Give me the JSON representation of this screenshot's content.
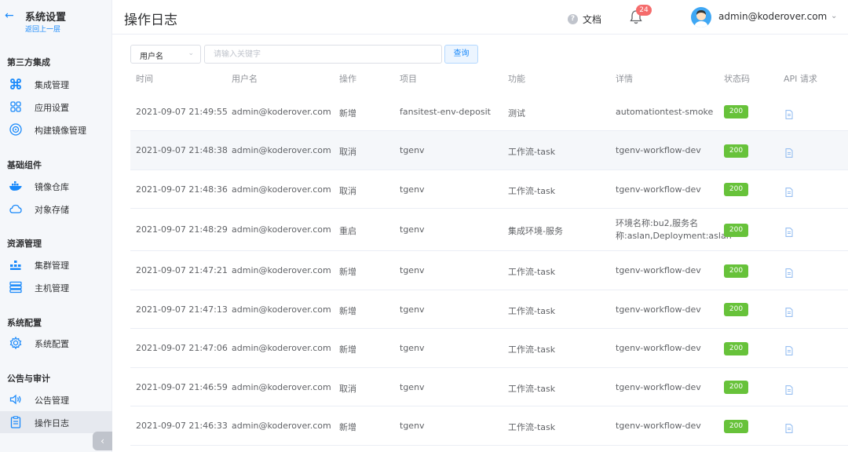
{
  "sidebar": {
    "title": "系统设置",
    "back_label": "返回上一层",
    "sections": [
      {
        "title": "第三方集成",
        "items": [
          {
            "label": "集成管理",
            "icon": "integration-icon"
          },
          {
            "label": "应用设置",
            "icon": "apps-grid-icon"
          },
          {
            "label": "构建镜像管理",
            "icon": "build-image-icon"
          }
        ]
      },
      {
        "title": "基础组件",
        "items": [
          {
            "label": "镜像仓库",
            "icon": "docker-icon"
          },
          {
            "label": "对象存储",
            "icon": "cloud-icon"
          }
        ]
      },
      {
        "title": "资源管理",
        "items": [
          {
            "label": "集群管理",
            "icon": "cluster-icon"
          },
          {
            "label": "主机管理",
            "icon": "server-icon"
          }
        ]
      },
      {
        "title": "系统配置",
        "items": [
          {
            "label": "系统配置",
            "icon": "gear-icon"
          }
        ]
      },
      {
        "title": "公告与审计",
        "items": [
          {
            "label": "公告管理",
            "icon": "speaker-icon"
          },
          {
            "label": "操作日志",
            "icon": "clipboard-icon",
            "active": true
          }
        ]
      }
    ],
    "collapse_icon": "chevron-left-icon"
  },
  "header": {
    "title": "操作日志",
    "docs_label": "文档",
    "notification_count": "24",
    "user_email": "admin@koderover.com"
  },
  "filter": {
    "field_value": "用户名",
    "keyword_placeholder": "请输入关键字",
    "search_label": "查询"
  },
  "table": {
    "columns": [
      "时间",
      "用户名",
      "操作",
      "项目",
      "功能",
      "详情",
      "状态码",
      "API 请求"
    ],
    "rows": [
      {
        "time": "2021-09-07 21:49:55",
        "user": "admin@koderover.com",
        "action": "新增",
        "project": "fansitest-env-deposit",
        "function": "测试",
        "detail": "automationtest-smoke",
        "status": "200"
      },
      {
        "time": "2021-09-07 21:48:38",
        "user": "admin@koderover.com",
        "action": "取消",
        "project": "tgenv",
        "function": "工作流-task",
        "detail": "tgenv-workflow-dev",
        "status": "200"
      },
      {
        "time": "2021-09-07 21:48:36",
        "user": "admin@koderover.com",
        "action": "取消",
        "project": "tgenv",
        "function": "工作流-task",
        "detail": "tgenv-workflow-dev",
        "status": "200"
      },
      {
        "time": "2021-09-07 21:48:29",
        "user": "admin@koderover.com",
        "action": "重启",
        "project": "tgenv",
        "function": "集成环境-服务",
        "detail": "环境名称:bu2,服务名称:aslan,Deployment:aslan",
        "status": "200"
      },
      {
        "time": "2021-09-07 21:47:21",
        "user": "admin@koderover.com",
        "action": "新增",
        "project": "tgenv",
        "function": "工作流-task",
        "detail": "tgenv-workflow-dev",
        "status": "200"
      },
      {
        "time": "2021-09-07 21:47:13",
        "user": "admin@koderover.com",
        "action": "新增",
        "project": "tgenv",
        "function": "工作流-task",
        "detail": "tgenv-workflow-dev",
        "status": "200"
      },
      {
        "time": "2021-09-07 21:47:06",
        "user": "admin@koderover.com",
        "action": "新增",
        "project": "tgenv",
        "function": "工作流-task",
        "detail": "tgenv-workflow-dev",
        "status": "200"
      },
      {
        "time": "2021-09-07 21:46:59",
        "user": "admin@koderover.com",
        "action": "取消",
        "project": "tgenv",
        "function": "工作流-task",
        "detail": "tgenv-workflow-dev",
        "status": "200"
      },
      {
        "time": "2021-09-07 21:46:33",
        "user": "admin@koderover.com",
        "action": "新增",
        "project": "tgenv",
        "function": "工作流-task",
        "detail": "tgenv-workflow-dev",
        "status": "200"
      }
    ]
  },
  "colors": {
    "accent": "#1989fa",
    "status_ok": "#67c23a",
    "badge": "#f56c6c"
  }
}
